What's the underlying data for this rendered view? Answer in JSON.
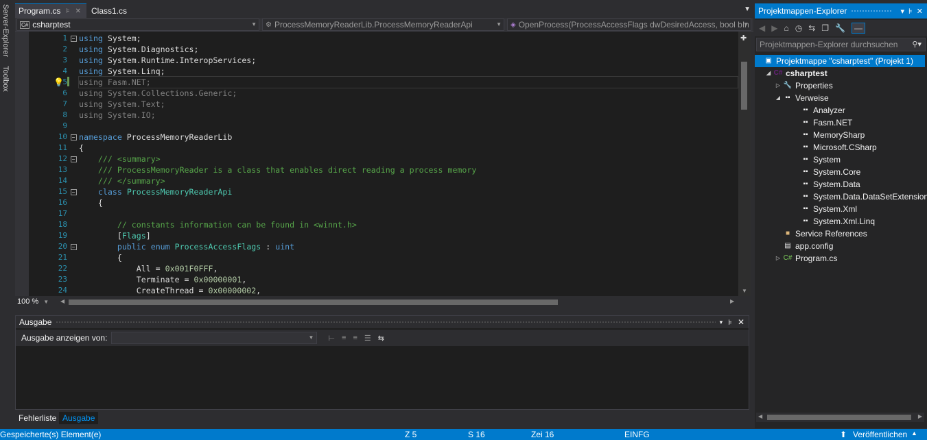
{
  "side_tabs": [
    "Server-Explorer",
    "Toolbox"
  ],
  "tabs": [
    {
      "label": "Program.cs",
      "active": true
    },
    {
      "label": "Class1.cs",
      "active": false
    }
  ],
  "nav": {
    "project": "csharptest",
    "class": "ProcessMemoryReaderLib.ProcessMemoryReaderApi",
    "member": "OpenProcess(ProcessAccessFlags dwDesiredAccess, bool bIn"
  },
  "editor": {
    "line_numbers": [
      "1",
      "2",
      "3",
      "4",
      "5",
      "6",
      "7",
      "8",
      "9",
      "10",
      "11",
      "12",
      "13",
      "14",
      "15",
      "16",
      "17",
      "18",
      "19",
      "20",
      "21",
      "22",
      "23",
      "24"
    ],
    "lines": [
      "using System;",
      "using System.Diagnostics;",
      "using System.Runtime.InteropServices;",
      "using System.Linq;",
      "using Fasm.NET;",
      "using System.Collections.Generic;",
      "using System.Text;",
      "using System.IO;",
      "",
      "namespace ProcessMemoryReaderLib",
      "{",
      "    /// <summary>",
      "    /// ProcessMemoryReader is a class that enables direct reading a process memory",
      "    /// </summary>",
      "    class ProcessMemoryReaderApi",
      "    {",
      "",
      "        // constants information can be found in <winnt.h>",
      "        [Flags]",
      "        public enum ProcessAccessFlags : uint",
      "        {",
      "            All = 0x001F0FFF,",
      "            Terminate = 0x00000001,",
      "            CreateThread = 0x00000002,"
    ],
    "zoom": "100 %"
  },
  "output": {
    "title": "Ausgabe",
    "show_label": "Ausgabe anzeigen von:",
    "source_value": ""
  },
  "bottom_tabs": [
    "Fehlerliste",
    "Ausgabe"
  ],
  "solution_explorer": {
    "title": "Projektmappen-Explorer",
    "search_placeholder": "Projektmappen-Explorer durchsuchen",
    "tree": {
      "solution": "Projektmappe \"csharptest\" (Projekt 1)",
      "project": "csharptest",
      "properties": "Properties",
      "references": "Verweise",
      "reference_items": [
        "Analyzer",
        "Fasm.NET",
        "MemorySharp",
        "Microsoft.CSharp",
        "System",
        "System.Core",
        "System.Data",
        "System.Data.DataSetExtension",
        "System.Xml",
        "System.Xml.Linq"
      ],
      "service_references": "Service References",
      "app_config": "app.config",
      "program": "Program.cs"
    }
  },
  "status": {
    "message": "Gespeicherte(s) Element(e)",
    "line": "Z 5",
    "column": "S 16",
    "char": "Zei 16",
    "mode": "EINFG",
    "publish": "Veröffentlichen"
  },
  "colors": {
    "accent": "#007acc",
    "keyword": "#569cd6",
    "type": "#4ec9b0",
    "comment": "#57a64a",
    "number": "#b5cea8",
    "line_number": "#2b91af"
  }
}
